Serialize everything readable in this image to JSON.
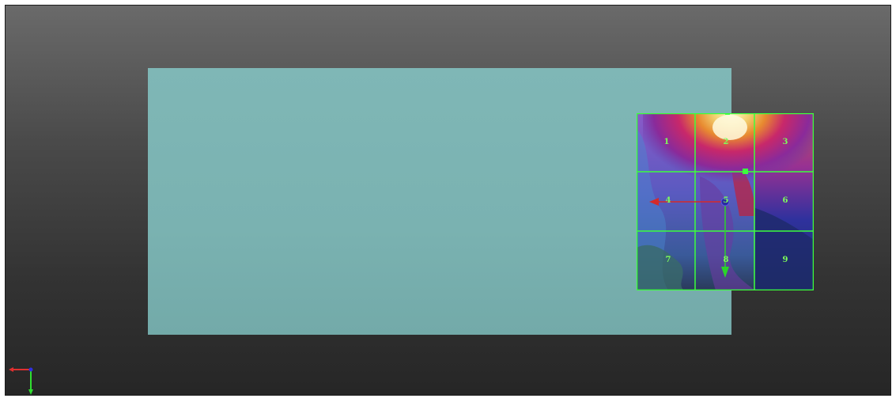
{
  "scene": {
    "name": "3d-viewport",
    "background_top": "#6a6a6a",
    "background_bottom": "#262626"
  },
  "slab": {
    "color": "#7ab2b1"
  },
  "grid_widget": {
    "line_color": "#3cff3c",
    "cells": [
      {
        "label": "1"
      },
      {
        "label": "2"
      },
      {
        "label": "3"
      },
      {
        "label": "4"
      },
      {
        "label": "5"
      },
      {
        "label": "6"
      },
      {
        "label": "7"
      },
      {
        "label": "8"
      },
      {
        "label": "9"
      }
    ]
  },
  "gizmo": {
    "x_arrow_color": "#d42a2a",
    "y_arrow_color": "#2ad42a",
    "center_color": "#2a2aa0"
  },
  "axis_tripod": {
    "x_color": "#e03030",
    "y_color": "#30e030",
    "z_color": "#3030e0"
  }
}
